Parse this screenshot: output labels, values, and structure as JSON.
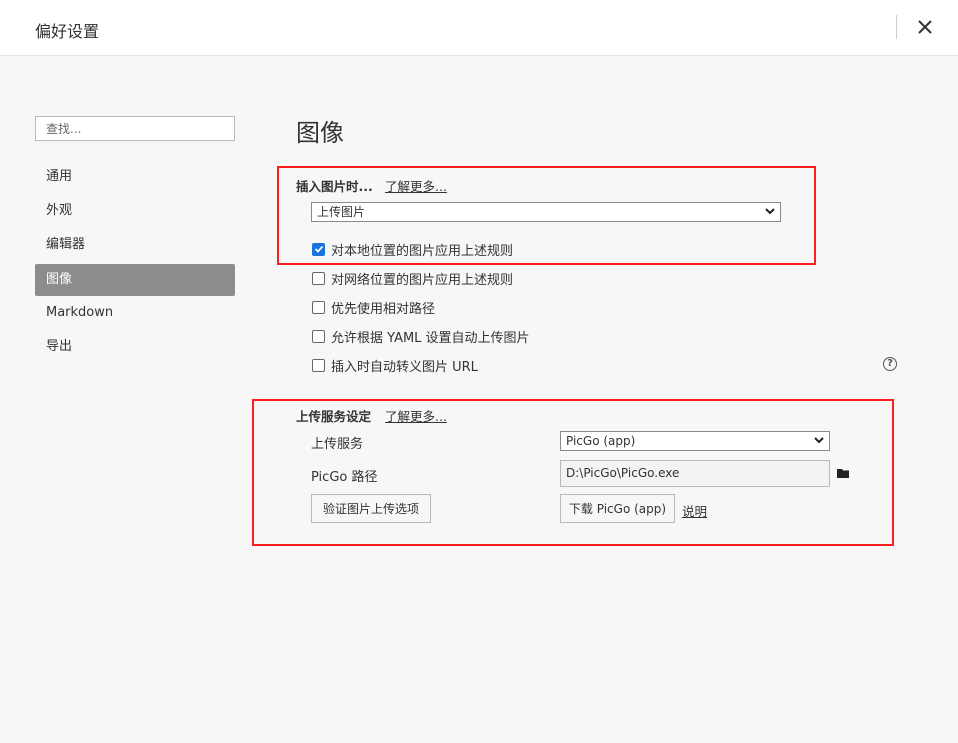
{
  "window": {
    "title": "偏好设置"
  },
  "sidebar": {
    "search_placeholder": "查找...",
    "items": [
      {
        "label": "通用"
      },
      {
        "label": "外观"
      },
      {
        "label": "编辑器"
      },
      {
        "label": "图像",
        "active": true
      },
      {
        "label": "Markdown"
      },
      {
        "label": "导出"
      }
    ]
  },
  "main": {
    "heading": "图像",
    "insert_section": {
      "label": "插入图片时...",
      "learn_more": "了解更多...",
      "action_select": "上传图片",
      "options": [
        {
          "label": "对本地位置的图片应用上述规则",
          "checked": true
        },
        {
          "label": "对网络位置的图片应用上述规则",
          "checked": false
        },
        {
          "label": "优先使用相对路径",
          "checked": false
        },
        {
          "label": "允许根据 YAML 设置自动上传图片",
          "checked": false
        },
        {
          "label": "插入时自动转义图片 URL",
          "checked": false
        }
      ],
      "help_icon": "?"
    },
    "upload_section": {
      "label": "上传服务设定",
      "learn_more": "了解更多...",
      "service_label": "上传服务",
      "service_value": "PicGo (app)",
      "path_label": "PicGo 路径",
      "path_value": "D:\\PicGo\\PicGo.exe",
      "verify_button": "验证图片上传选项",
      "download_button": "下载 PicGo (app)",
      "docs_link": "说明"
    }
  },
  "colors": {
    "highlight_box": "#ff1c1c",
    "active_nav": "#8c8c8c",
    "checkbox": "#1a73d9"
  }
}
